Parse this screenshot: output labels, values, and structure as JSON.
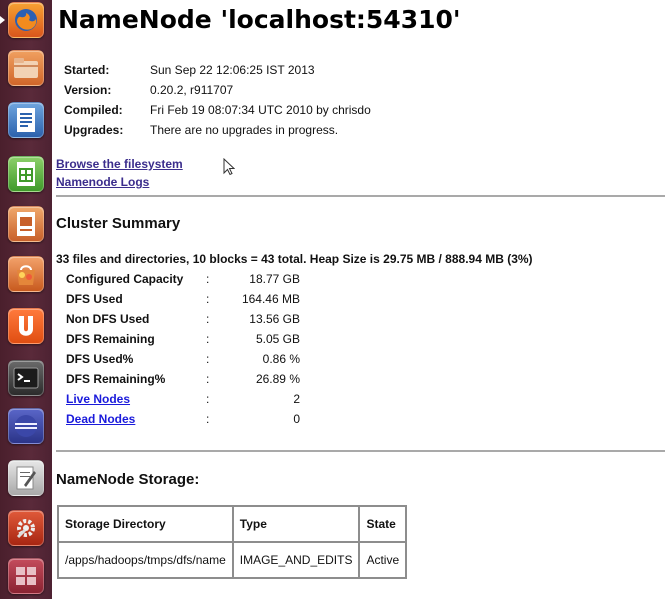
{
  "launcher": {
    "items": [
      {
        "name": "firefox"
      },
      {
        "name": "files"
      },
      {
        "name": "writer"
      },
      {
        "name": "calc"
      },
      {
        "name": "impress"
      },
      {
        "name": "software-center"
      },
      {
        "name": "ubuntu-one"
      },
      {
        "name": "terminal"
      },
      {
        "name": "eclipse"
      },
      {
        "name": "text-editor"
      },
      {
        "name": "system-settings"
      },
      {
        "name": "workspace-switcher"
      }
    ]
  },
  "title": "NameNode 'localhost:54310'",
  "info": {
    "started_label": "Started:",
    "started_value": "Sun Sep 22 12:06:25 IST 2013",
    "version_label": "Version:",
    "version_value": "0.20.2, r911707",
    "compiled_label": "Compiled:",
    "compiled_value": "Fri Feb 19 08:07:34 UTC 2010 by chrisdo",
    "upgrades_label": "Upgrades:",
    "upgrades_value": "There are no upgrades in progress."
  },
  "links": {
    "browse": "Browse the filesystem",
    "logs": "Namenode Logs"
  },
  "cluster_summary": {
    "title": "Cluster Summary",
    "summary_line": "33 files and directories, 10 blocks = 43 total. Heap Size is 29.75 MB / 888.94 MB (3%)",
    "separator": ":",
    "stats": {
      "configured_capacity": {
        "label": "Configured Capacity",
        "value": "18.77 GB"
      },
      "dfs_used": {
        "label": "DFS Used",
        "value": "164.46 MB"
      },
      "non_dfs_used": {
        "label": "Non DFS Used",
        "value": "13.56 GB"
      },
      "dfs_remaining": {
        "label": "DFS Remaining",
        "value": "5.05 GB"
      },
      "dfs_used_pct": {
        "label": "DFS Used%",
        "value": "0.86 %"
      },
      "dfs_remaining_pct": {
        "label": "DFS Remaining%",
        "value": "26.89 %"
      },
      "live_nodes": {
        "label": "Live Nodes",
        "value": "2"
      },
      "dead_nodes": {
        "label": "Dead Nodes",
        "value": "0"
      }
    }
  },
  "storage": {
    "title": "NameNode Storage:",
    "headers": {
      "directory": "Storage Directory",
      "type": "Type",
      "state": "State"
    },
    "rows": [
      {
        "directory": "/apps/hadoops/tmps/dfs/name",
        "type": "IMAGE_AND_EDITS",
        "state": "Active"
      }
    ]
  },
  "colors": {
    "launcher_bg": "#4a1f2c",
    "link": "#3b2d8c",
    "node_link": "#1a1adb",
    "rule": "#a9a9a9"
  }
}
